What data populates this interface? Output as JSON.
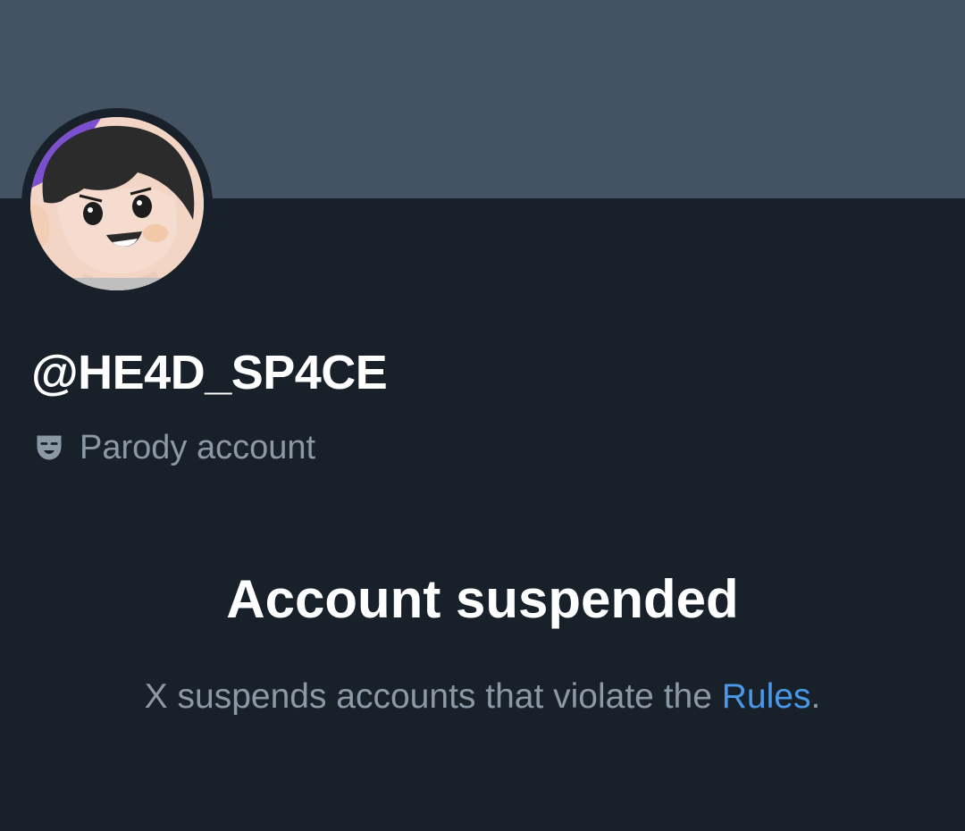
{
  "profile": {
    "handle": "@HE4D_SP4CE",
    "badge_icon": "theater-mask-icon",
    "badge_label": "Parody account"
  },
  "notice": {
    "title": "Account suspended",
    "description_prefix": "X suspends accounts that violate the ",
    "rules_link": "Rules",
    "description_suffix": "."
  },
  "colors": {
    "banner": "#435363",
    "background": "#18202a",
    "muted_text": "#8b98a5",
    "link": "#4a99e9"
  }
}
